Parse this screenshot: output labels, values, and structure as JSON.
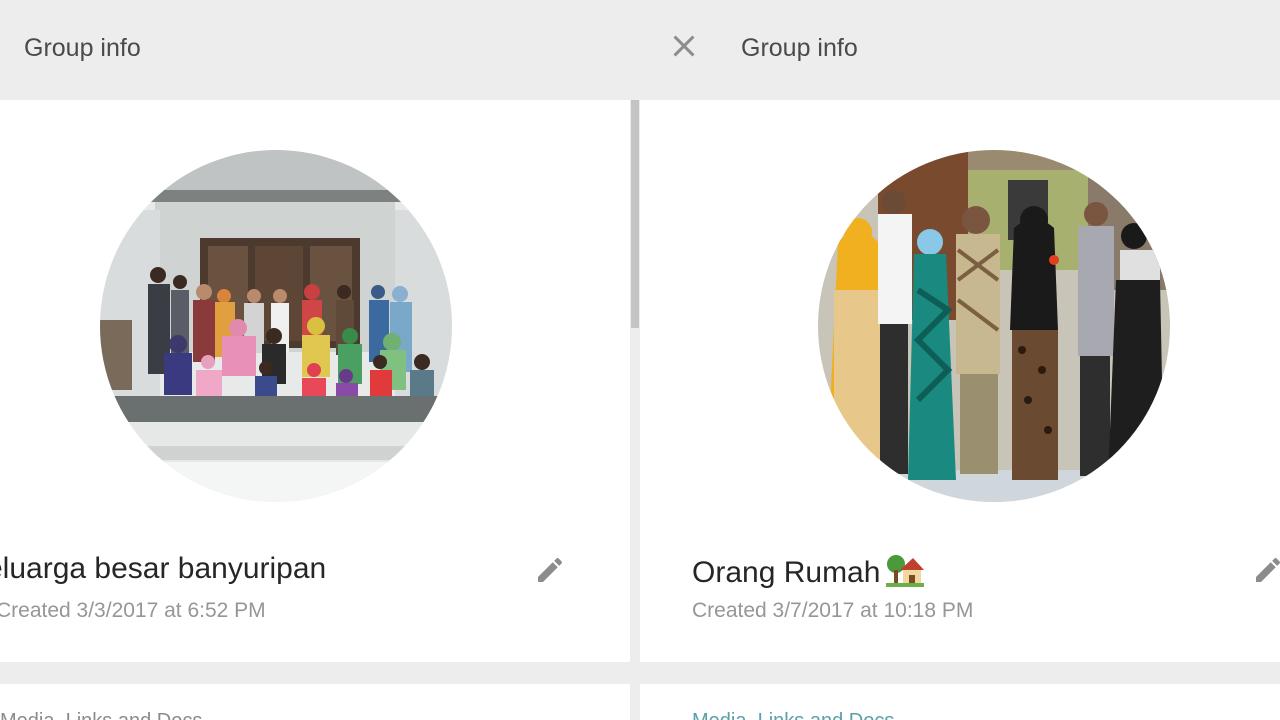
{
  "left_panel": {
    "header_title": "Group info",
    "group_name": "eluarga besar banyuripan",
    "created": "Created 3/3/2017 at 6:52 PM",
    "lower_text": "Media, Links and Docs",
    "avatar_icon": "group-photo",
    "edit_icon": "pencil-icon"
  },
  "right_panel": {
    "header_title": "Group info",
    "close_icon": "close-icon",
    "group_name": "Orang Rumah",
    "name_emoji": "house-with-garden-icon",
    "created": "Created 3/7/2017 at 10:18 PM",
    "lower_text": "Media, Links and Docs",
    "avatar_icon": "group-photo",
    "edit_icon": "pencil-icon"
  },
  "colors": {
    "header_bg": "#ededed",
    "card_bg": "#ffffff",
    "text_primary": "#262626",
    "text_secondary": "#969696",
    "icon": "#8c8c8c"
  }
}
